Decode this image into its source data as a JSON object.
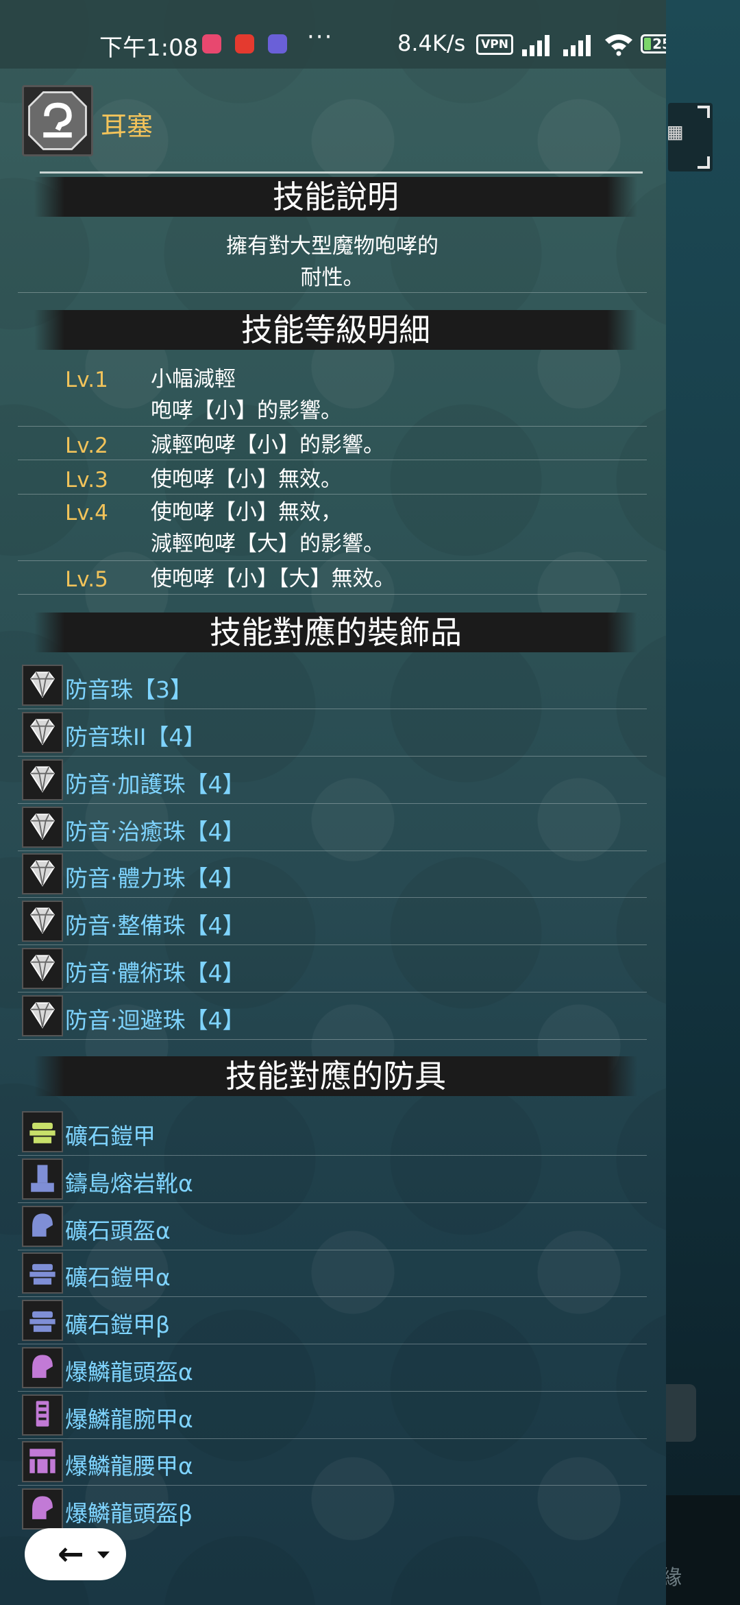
{
  "status_bar": {
    "time": "下午1:08",
    "dots": "···",
    "speed": "8.4K/s",
    "vpn": "VPN",
    "battery": "25"
  },
  "skill": {
    "name": "耳塞"
  },
  "sections": {
    "description_title": "技能說明",
    "levels_title": "技能等級明細",
    "decorations_title": "技能對應的裝飾品",
    "armor_title": "技能對應的防具"
  },
  "description": {
    "line1": "擁有對大型魔物咆哮的",
    "line2": "耐性。"
  },
  "levels": [
    {
      "label": "Lv.1",
      "line1": "小幅減輕",
      "line2": "咆哮【小】的影響。"
    },
    {
      "label": "Lv.2",
      "line1": "減輕咆哮【小】的影響。",
      "line2": ""
    },
    {
      "label": "Lv.3",
      "line1": "使咆哮【小】無效。",
      "line2": ""
    },
    {
      "label": "Lv.4",
      "line1": "使咆哮【小】無效，",
      "line2": "減輕咆哮【大】的影響。"
    },
    {
      "label": "Lv.5",
      "line1": "使咆哮【小】【大】無效。",
      "line2": ""
    }
  ],
  "decorations": [
    {
      "name": "防音珠【3】",
      "icon": "gem-icon"
    },
    {
      "name": "防音珠II【4】",
      "icon": "gem-icon"
    },
    {
      "name": "防音·加護珠【4】",
      "icon": "gem-icon"
    },
    {
      "name": "防音·治癒珠【4】",
      "icon": "gem-icon"
    },
    {
      "name": "防音·體力珠【4】",
      "icon": "gem-icon"
    },
    {
      "name": "防音·整備珠【4】",
      "icon": "gem-icon"
    },
    {
      "name": "防音·體術珠【4】",
      "icon": "gem-icon"
    },
    {
      "name": "防音·迴避珠【4】",
      "icon": "gem-icon"
    }
  ],
  "armor": [
    {
      "name": "礦石鎧甲",
      "icon": "chest-armor-icon",
      "color": "#c8e06a"
    },
    {
      "name": "鑄島熔岩靴α",
      "icon": "leg-armor-icon",
      "color": "#7f8fd6"
    },
    {
      "name": "礦石頭盔α",
      "icon": "helm-armor-icon",
      "color": "#7f8fd6"
    },
    {
      "name": "礦石鎧甲α",
      "icon": "chest-armor-icon",
      "color": "#7f8fd6"
    },
    {
      "name": "礦石鎧甲β",
      "icon": "chest-armor-icon",
      "color": "#7f8fd6"
    },
    {
      "name": "爆鱗龍頭盔α",
      "icon": "helm-armor-icon",
      "color": "#c27ad6"
    },
    {
      "name": "爆鱗龍腕甲α",
      "icon": "arm-armor-icon",
      "color": "#c27ad6"
    },
    {
      "name": "爆鱗龍腰甲α",
      "icon": "waist-armor-icon",
      "color": "#c27ad6"
    },
    {
      "name": "爆鱗龍頭盔β",
      "icon": "helm-armor-icon",
      "color": "#c27ad6"
    }
  ],
  "colors": {
    "link": "#7fd4ff",
    "level_label": "#f2c35a",
    "skill_name": "#f2c35a"
  },
  "background": {
    "corner_text": "緣"
  }
}
